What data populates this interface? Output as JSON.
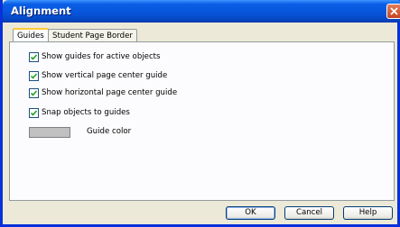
{
  "window": {
    "title": "Alignment"
  },
  "tabs": [
    {
      "label": "Guides",
      "active": true
    },
    {
      "label": "Student Page Border",
      "active": false
    }
  ],
  "options": [
    {
      "label": "Show guides for active objects",
      "checked": true
    },
    {
      "label": "Show vertical page center guide",
      "checked": true
    },
    {
      "label": "Show horizontal page center guide",
      "checked": true
    },
    {
      "label": "Snap objects to guides",
      "checked": true
    }
  ],
  "guide_color": {
    "label": "Guide color",
    "value": "#c0c0c0"
  },
  "buttons": {
    "ok": "OK",
    "cancel": "Cancel",
    "help": "Help"
  }
}
